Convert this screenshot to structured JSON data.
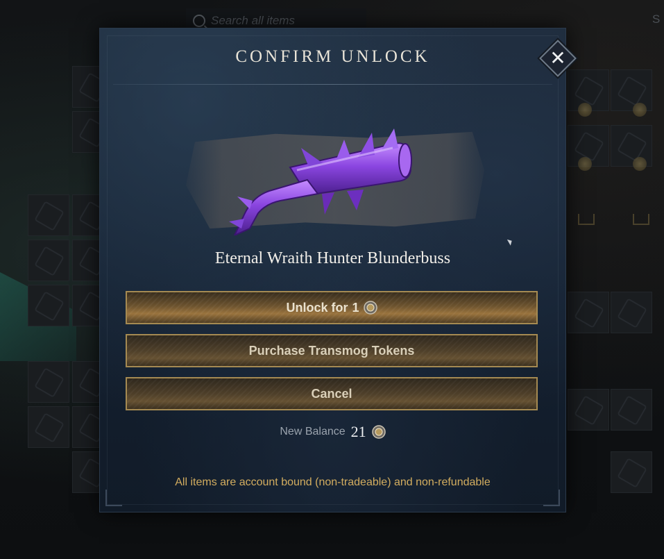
{
  "background": {
    "search_placeholder": "Search all items",
    "partial_label": "S"
  },
  "dialog": {
    "title": "CONFIRM UNLOCK",
    "close_icon": "close-icon",
    "item_name": "Eternal Wraith Hunter Blunderbuss",
    "item_icon": "blunderbuss-icon",
    "unlock_label_prefix": "Unlock for",
    "unlock_cost": "1",
    "purchase_label": "Purchase Transmog Tokens",
    "cancel_label": "Cancel",
    "balance_label": "New Balance",
    "balance_value": "21",
    "token_icon": "transmog-token-icon",
    "disclaimer": "All items are account bound (non-tradeable) and non-refundable"
  },
  "colors": {
    "accent_gold": "#a58a52",
    "disclaimer_gold": "#d3ad5f",
    "weapon_purple": "#7b3fd0",
    "panel_blue": "#1d2a3a"
  }
}
